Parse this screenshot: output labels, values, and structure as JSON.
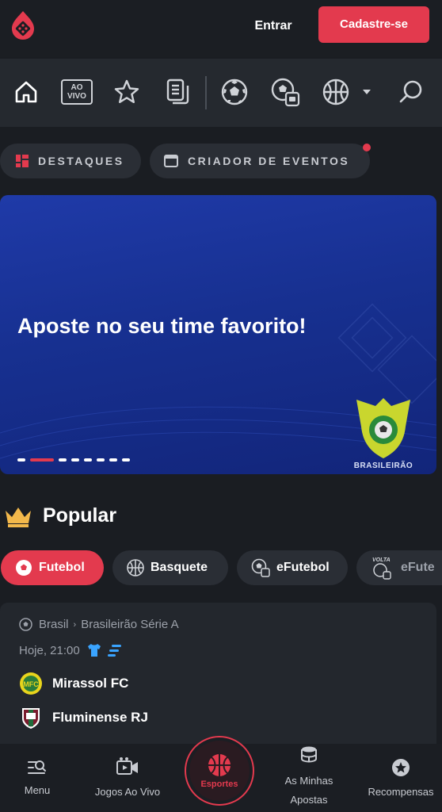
{
  "header": {
    "login_label": "Entrar",
    "signup_label": "Cadastre-se"
  },
  "toolbar": {
    "live_badge_line1": "AO",
    "live_badge_line2": "VIVO"
  },
  "pills": {
    "highlights_label": "DESTAQUES",
    "event_creator_label": "CRIADOR DE EVENTOS"
  },
  "banner": {
    "title": "Aposte no seu time favorito!",
    "trophy_label": "BRASILEIRÃO",
    "slide_count": 8,
    "active_slide": 2
  },
  "popular": {
    "title": "Popular",
    "tabs": [
      {
        "label": "Futebol",
        "icon": "soccer-ball-icon",
        "active": true
      },
      {
        "label": "Basquete",
        "icon": "basketball-icon",
        "active": false
      },
      {
        "label": "eFutebol",
        "icon": "esoccer-icon",
        "active": false
      },
      {
        "label": "eFute",
        "icon": "volta-icon",
        "active": false
      }
    ]
  },
  "match": {
    "country": "Brasil",
    "league": "Brasileirão Série A",
    "datetime": "Hoje, 21:00",
    "home_team": "Mirassol FC",
    "away_team": "Fluminense RJ"
  },
  "bottom_nav": {
    "menu_label": "Menu",
    "live_games_label": "Jogos Ao Vivo",
    "sports_label": "Esportes",
    "my_bets_line1": "As Minhas",
    "my_bets_line2": "Apostas",
    "rewards_label": "Recompensas"
  },
  "colors": {
    "accent": "#e33a4e",
    "background": "#1a1d22",
    "toolbar": "#25292f",
    "banner": "#1a339a"
  }
}
